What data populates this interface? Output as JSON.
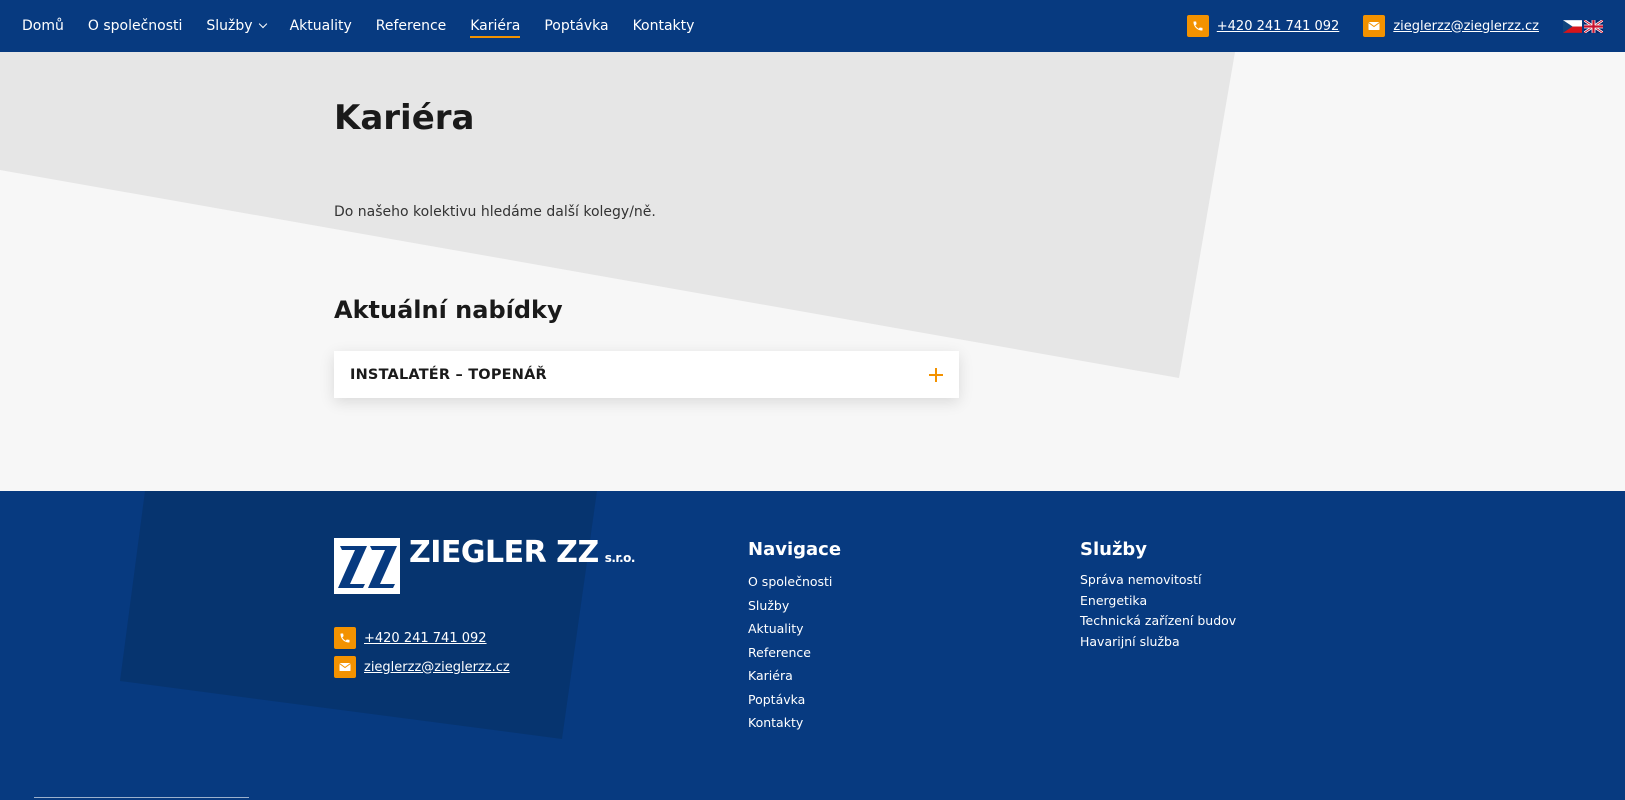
{
  "nav": {
    "items": [
      {
        "label": "Domů",
        "active": false
      },
      {
        "label": "O společnosti",
        "active": false
      },
      {
        "label": "Služby",
        "active": false,
        "dropdown": true
      },
      {
        "label": "Aktuality",
        "active": false
      },
      {
        "label": "Reference",
        "active": false
      },
      {
        "label": "Kariéra",
        "active": true
      },
      {
        "label": "Poptávka",
        "active": false
      },
      {
        "label": "Kontakty",
        "active": false
      }
    ],
    "phone": "+420 241 741 092",
    "email": "zieglerzz@zieglerzz.cz",
    "languages": [
      "cs",
      "en"
    ]
  },
  "main": {
    "title": "Kariéra",
    "intro": "Do našeho kolektivu hledáme další kolegy/ně.",
    "offers_title": "Aktuální nabídky",
    "offers": [
      {
        "title": "INSTALATÉR – TOPENÁŘ"
      }
    ]
  },
  "footer": {
    "logo_text": "ZIEGLER ZZ",
    "logo_suffix": "s.r.o.",
    "phone": "+420 241 741 092",
    "email": "zieglerzz@zieglerzz.cz",
    "navigation": {
      "heading": "Navigace",
      "items": [
        "O společnosti",
        "Služby",
        "Aktuality",
        "Reference",
        "Kariéra",
        "Poptávka",
        "Kontakty"
      ]
    },
    "services": {
      "heading": "Služby",
      "items": [
        "Správa nemovitostí",
        "Energetika",
        "Technická zařízení budov",
        "Havarijní služba"
      ]
    }
  },
  "colors": {
    "brand_blue": "#073a80",
    "accent_orange": "#f39200",
    "background": "#f7f7f7",
    "hero_grey": "#e6e6e6"
  }
}
